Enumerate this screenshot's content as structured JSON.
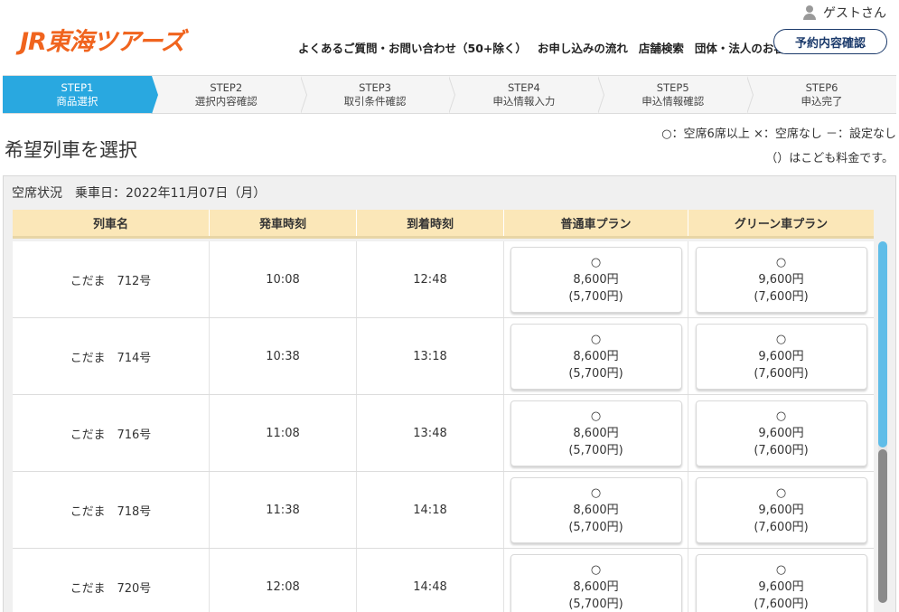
{
  "header": {
    "logo": "JR東海ツアーズ",
    "guest_label": "ゲストさん",
    "nav": [
      "よくあるご質問・お問い合わせ（50+除く）",
      "お申し込みの流れ",
      "店舗検索",
      "団体・法人のお客様"
    ],
    "confirm_button": "予約内容確認"
  },
  "steps": [
    {
      "num": "STEP1",
      "label": "商品選択",
      "active": true
    },
    {
      "num": "STEP2",
      "label": "選択内容確認"
    },
    {
      "num": "STEP3",
      "label": "取引条件確認"
    },
    {
      "num": "STEP4",
      "label": "申込情報入力"
    },
    {
      "num": "STEP5",
      "label": "申込情報確認"
    },
    {
      "num": "STEP6",
      "label": "申込完了"
    }
  ],
  "page": {
    "title": "希望列車を選択",
    "legend_line1": "○：空席6席以上 ×：空席なし －：設定なし",
    "legend_line2": "（）はこども料金です。"
  },
  "panel": {
    "heading": "空席状況　乗車日：2022年11月07日（月）",
    "columns": [
      "列車名",
      "発車時刻",
      "到着時刻",
      "普通車プラン",
      "グリーン車プラン"
    ],
    "rows": [
      {
        "name": "こだま　712号",
        "dep": "10:08",
        "arr": "12:48",
        "normal": {
          "mark": "○",
          "price": "8,600円",
          "child": "(5,700円)"
        },
        "green": {
          "mark": "○",
          "price": "9,600円",
          "child": "(7,600円)"
        }
      },
      {
        "name": "こだま　714号",
        "dep": "10:38",
        "arr": "13:18",
        "normal": {
          "mark": "○",
          "price": "8,600円",
          "child": "(5,700円)"
        },
        "green": {
          "mark": "○",
          "price": "9,600円",
          "child": "(7,600円)"
        }
      },
      {
        "name": "こだま　716号",
        "dep": "11:08",
        "arr": "13:48",
        "normal": {
          "mark": "○",
          "price": "8,600円",
          "child": "(5,700円)"
        },
        "green": {
          "mark": "○",
          "price": "9,600円",
          "child": "(7,600円)"
        }
      },
      {
        "name": "こだま　718号",
        "dep": "11:38",
        "arr": "14:18",
        "normal": {
          "mark": "○",
          "price": "8,600円",
          "child": "(5,700円)"
        },
        "green": {
          "mark": "○",
          "price": "9,600円",
          "child": "(7,600円)"
        }
      },
      {
        "name": "こだま　720号",
        "dep": "12:08",
        "arr": "14:48",
        "normal": {
          "mark": "○",
          "price": "8,600円",
          "child": "(5,700円)"
        },
        "green": {
          "mark": "○",
          "price": "9,600円",
          "child": "(7,600円)"
        }
      }
    ]
  },
  "colors": {
    "brand": "#f0641e",
    "step_active": "#29a8e0",
    "table_header": "#fbe7b8",
    "button_border": "#1b3a6b"
  }
}
